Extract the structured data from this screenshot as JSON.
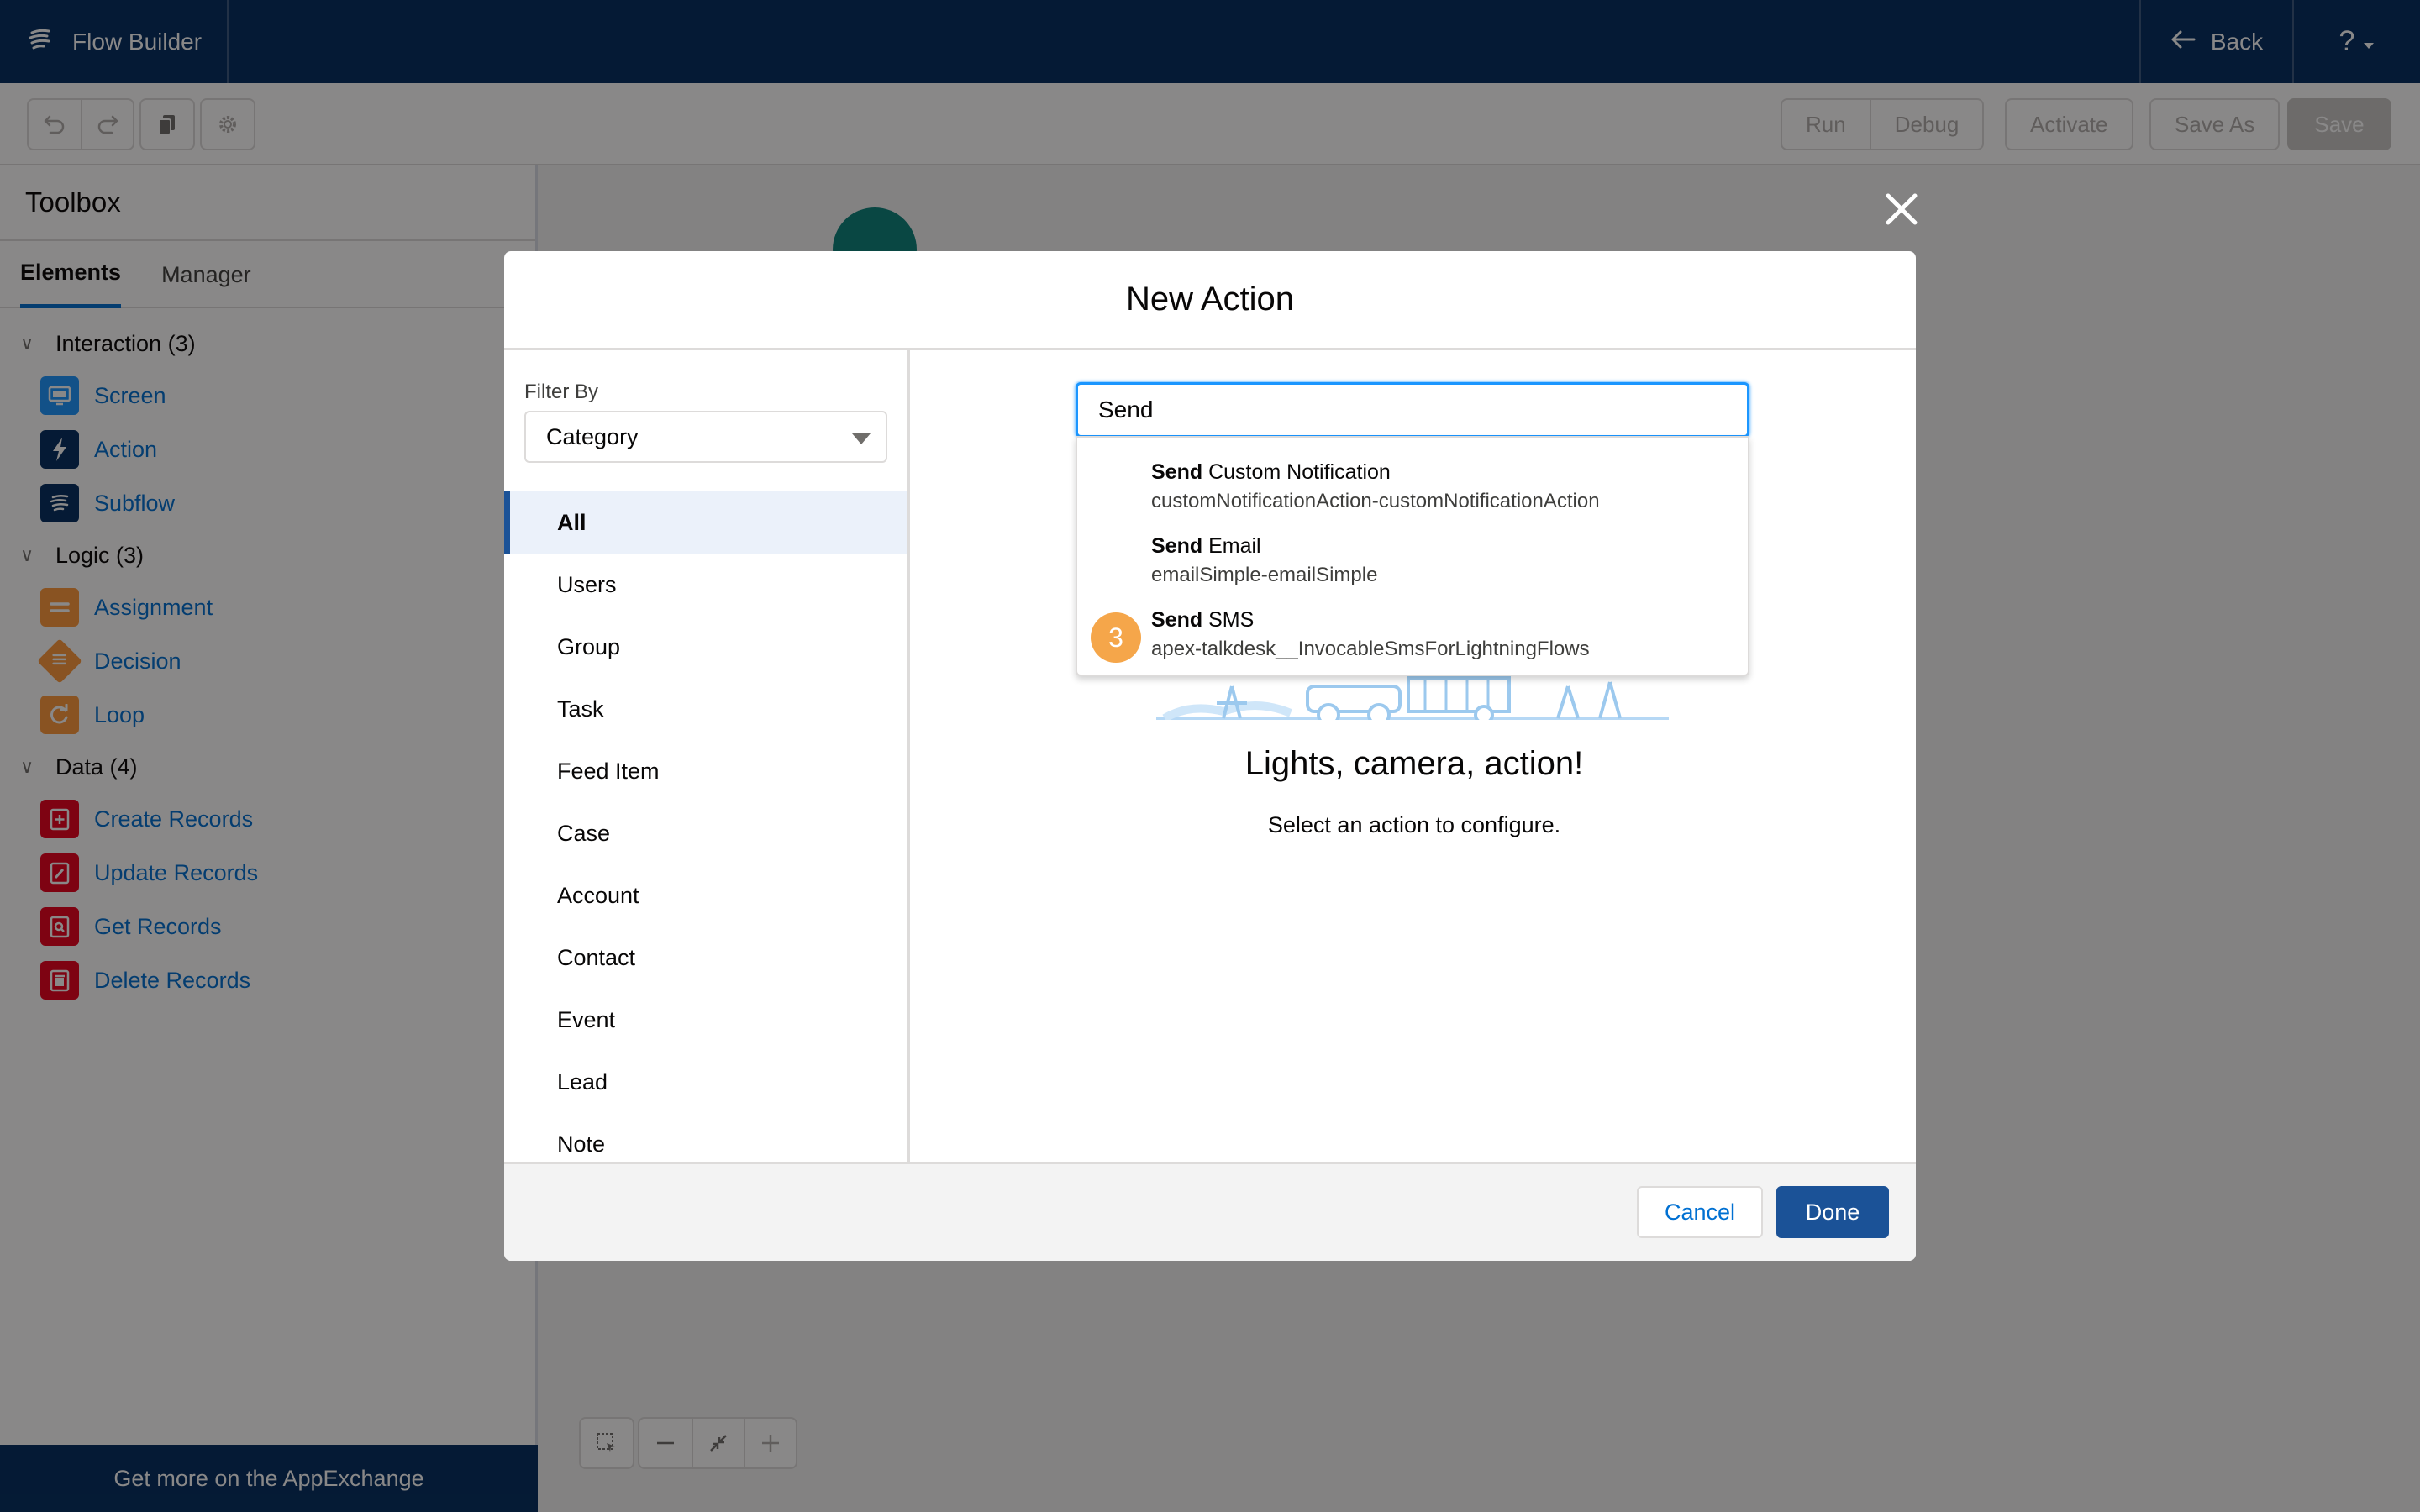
{
  "header": {
    "app_title": "Flow Builder",
    "back_label": "Back",
    "help_label": "?"
  },
  "toolbar": {
    "run_label": "Run",
    "debug_label": "Debug",
    "activate_label": "Activate",
    "save_as_label": "Save As",
    "save_label": "Save"
  },
  "sidebar": {
    "title": "Toolbox",
    "tabs": [
      {
        "label": "Elements",
        "active": true
      },
      {
        "label": "Manager",
        "active": false
      }
    ],
    "sections": [
      {
        "label": "Interaction (3)",
        "items": [
          {
            "label": "Screen",
            "icon": "screen-icon",
            "color": "#1b96ff"
          },
          {
            "label": "Action",
            "icon": "lightning-icon",
            "color": "#032d60"
          },
          {
            "label": "Subflow",
            "icon": "flow-icon",
            "color": "#032d60"
          }
        ]
      },
      {
        "label": "Logic (3)",
        "items": [
          {
            "label": "Assignment",
            "icon": "equals-icon",
            "color": "#ff9a3c"
          },
          {
            "label": "Decision",
            "icon": "decision-icon",
            "color": "#ff9a3c"
          },
          {
            "label": "Loop",
            "icon": "loop-icon",
            "color": "#ff9a3c"
          }
        ]
      },
      {
        "label": "Data (4)",
        "items": [
          {
            "label": "Create Records",
            "icon": "create-record-icon",
            "color": "#ea001e"
          },
          {
            "label": "Update Records",
            "icon": "update-record-icon",
            "color": "#ea001e"
          },
          {
            "label": "Get Records",
            "icon": "get-record-icon",
            "color": "#ea001e"
          },
          {
            "label": "Delete Records",
            "icon": "delete-record-icon",
            "color": "#ea001e"
          }
        ]
      }
    ],
    "footer_label": "Get more on the AppExchange"
  },
  "modal": {
    "title": "New Action",
    "filter_label": "Filter By",
    "filter_value": "Category",
    "categories": [
      "All",
      "Users",
      "Group",
      "Task",
      "Feed Item",
      "Case",
      "Account",
      "Contact",
      "Event",
      "Lead",
      "Note"
    ],
    "active_category": "All",
    "search_value": "Send",
    "results": [
      {
        "bold": "Send",
        "rest": " Custom Notification",
        "api": "customNotificationAction-customNotificationAction"
      },
      {
        "bold": "Send",
        "rest": " Email",
        "api": "emailSimple-emailSimple"
      },
      {
        "bold": "Send",
        "rest": " SMS",
        "api": "apex-talkdesk__InvocableSmsForLightningFlows"
      }
    ],
    "step_badge": "3",
    "empty_title": "Lights, camera, action!",
    "empty_subtitle": "Select an action to configure.",
    "cancel_label": "Cancel",
    "done_label": "Done"
  },
  "colors": {
    "header_bg": "#032d60",
    "brand_blue": "#1b5297",
    "link_blue": "#0070d2",
    "focus_blue": "#1b96ff",
    "badge_orange": "#f5a64a"
  }
}
